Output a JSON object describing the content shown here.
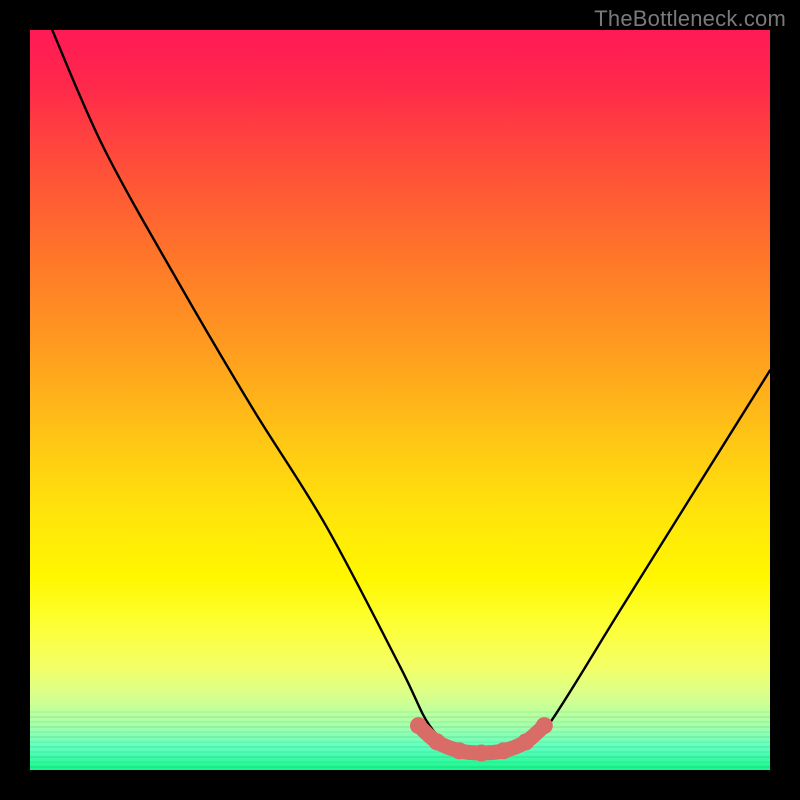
{
  "watermark": "TheBottleneck.com",
  "chart_data": {
    "type": "line",
    "title": "",
    "xlabel": "",
    "ylabel": "",
    "xlim": [
      0,
      100
    ],
    "ylim": [
      0,
      100
    ],
    "grid": false,
    "series": [
      {
        "name": "bottleneck-curve",
        "x": [
          3,
          10,
          20,
          30,
          40,
          50,
          54,
          58,
          62,
          66,
          70,
          80,
          90,
          100
        ],
        "y": [
          100,
          84,
          66,
          49,
          33,
          14,
          6,
          2.5,
          2,
          2.5,
          6,
          22,
          38,
          54
        ]
      }
    ],
    "highlight": {
      "name": "optimal-range",
      "x": [
        52.5,
        55,
        58,
        61,
        64,
        67,
        69.5
      ],
      "y": [
        6,
        3.8,
        2.6,
        2.3,
        2.6,
        3.8,
        6
      ]
    },
    "gradient_stops": [
      {
        "pos": 0,
        "color": "#ff1a56"
      },
      {
        "pos": 14,
        "color": "#ff4040"
      },
      {
        "pos": 32,
        "color": "#ff7a28"
      },
      {
        "pos": 56,
        "color": "#ffc814"
      },
      {
        "pos": 74,
        "color": "#fff700"
      },
      {
        "pos": 90,
        "color": "#d8ff8c"
      },
      {
        "pos": 100,
        "color": "#17f78b"
      }
    ]
  }
}
